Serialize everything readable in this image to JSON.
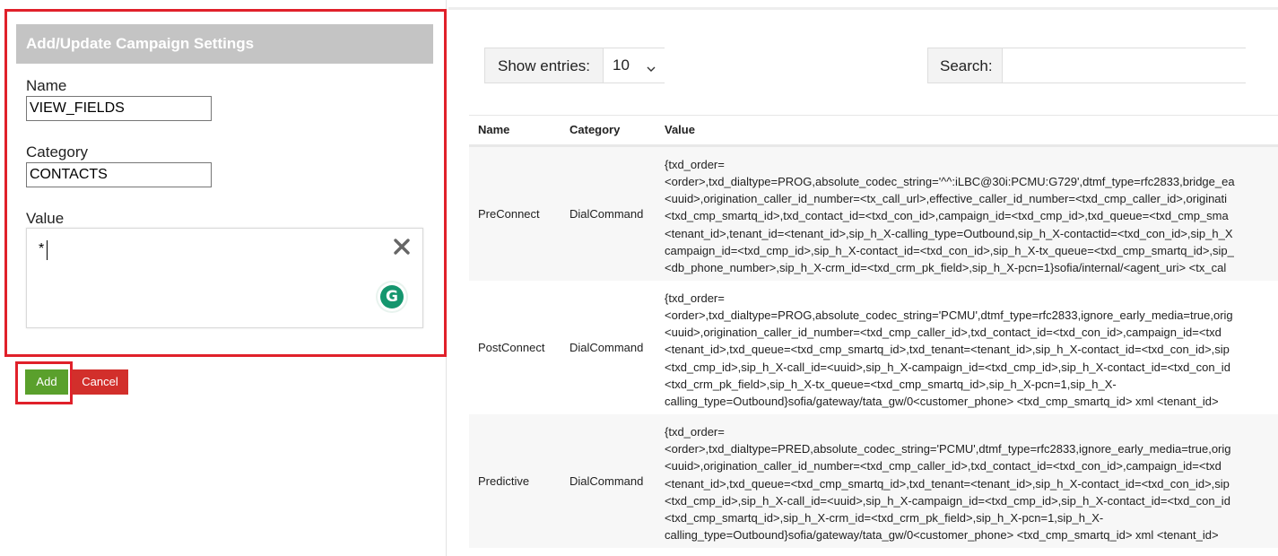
{
  "form": {
    "header": "Add/Update Campaign Settings",
    "name_label": "Name",
    "name_value": "VIEW_FIELDS",
    "category_label": "Category",
    "category_value": "CONTACTS",
    "value_label": "Value",
    "value_text": "*",
    "add_label": "Add",
    "cancel_label": "Cancel"
  },
  "table_controls": {
    "show_entries_label": "Show entries:",
    "show_entries_value": "10",
    "search_label": "Search:"
  },
  "table": {
    "headers": [
      "Name",
      "Category",
      "Value"
    ],
    "rows": [
      {
        "name": "PreConnect",
        "category": "DialCommand",
        "value_lines": [
          "{txd_order=",
          "<order>,txd_dialtype=PROG,absolute_codec_string='^^:iLBC@30i:PCMU:G729',dtmf_type=rfc2833,bridge_ea",
          "<uuid>,origination_caller_id_number=<tx_call_url>,effective_caller_id_number=<txd_cmp_caller_id>,originati",
          "<txd_cmp_smartq_id>,txd_contact_id=<txd_con_id>,campaign_id=<txd_cmp_id>,txd_queue=<txd_cmp_sma",
          "<tenant_id>,tenant_id=<tenant_id>,sip_h_X-calling_type=Outbound,sip_h_X-contactid=<txd_con_id>,sip_h_X",
          "campaign_id=<txd_cmp_id>,sip_h_X-contact_id=<txd_con_id>,sip_h_X-tx_queue=<txd_cmp_smartq_id>,sip_",
          "<db_phone_number>,sip_h_X-crm_id=<txd_crm_pk_field>,sip_h_X-pcn=1}sofia/internal/<agent_uri> <tx_cal"
        ]
      },
      {
        "name": "PostConnect",
        "category": "DialCommand",
        "value_lines": [
          "{txd_order=",
          "<order>,txd_dialtype=PROG,absolute_codec_string='PCMU',dtmf_type=rfc2833,ignore_early_media=true,orig",
          "<uuid>,origination_caller_id_number=<txd_cmp_caller_id>,txd_contact_id=<txd_con_id>,campaign_id=<txd",
          "<tenant_id>,txd_queue=<txd_cmp_smartq_id>,txd_tenant=<tenant_id>,sip_h_X-contact_id=<txd_con_id>,sip",
          "<txd_cmp_id>,sip_h_X-call_id=<uuid>,sip_h_X-campaign_id=<txd_cmp_id>,sip_h_X-contact_id=<txd_con_id",
          "<txd_crm_pk_field>,sip_h_X-tx_queue=<txd_cmp_smartq_id>,sip_h_X-pcn=1,sip_h_X-",
          "calling_type=Outbound}sofia/gateway/tata_gw/0<customer_phone> <txd_cmp_smartq_id> xml <tenant_id>"
        ]
      },
      {
        "name": "Predictive",
        "category": "DialCommand",
        "value_lines": [
          "{txd_order=",
          "<order>,txd_dialtype=PRED,absolute_codec_string='PCMU',dtmf_type=rfc2833,ignore_early_media=true,orig",
          "<uuid>,origination_caller_id_number=<txd_cmp_caller_id>,txd_contact_id=<txd_con_id>,campaign_id=<txd",
          "<tenant_id>,txd_queue=<txd_cmp_smartq_id>,txd_tenant=<tenant_id>,sip_h_X-contact_id=<txd_con_id>,sip",
          "<txd_cmp_id>,sip_h_X-call_id=<uuid>,sip_h_X-campaign_id=<txd_cmp_id>,sip_h_X-contact_id=<txd_con_id",
          "<txd_cmp_smartq_id>,sip_h_X-crm_id=<txd_crm_pk_field>,sip_h_X-pcn=1,sip_h_X-",
          "calling_type=Outbound}sofia/gateway/tata_gw/0<customer_phone> <txd_cmp_smartq_id> xml <tenant_id>"
        ]
      }
    ]
  },
  "icons": {
    "clear": "close-icon",
    "grammarly": "grammarly-icon",
    "dropdown": "chevron-down-icon"
  },
  "colors": {
    "highlight_red": "#e0202a",
    "add_green": "#5aa02c",
    "cancel_red": "#d22f2b",
    "header_gray": "#c4c4c4",
    "grammarly_green": "#15966e"
  }
}
